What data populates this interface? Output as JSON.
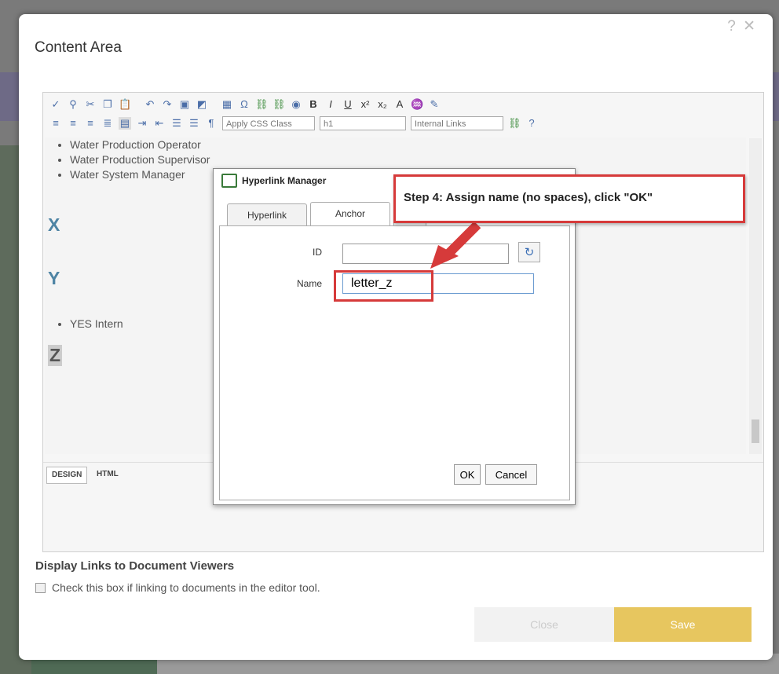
{
  "modal": {
    "title": "Content Area",
    "help_icon": "?",
    "close_icon": "✕"
  },
  "toolbar": {
    "row1_icons": [
      "spellcheck-icon",
      "find-icon",
      "cut-icon",
      "copy-icon",
      "paste-icon",
      "undo-icon",
      "redo-icon",
      "image-manager-icon",
      "image-map-icon",
      "table-icon",
      "symbol-icon",
      "hyperlink-icon",
      "remove-link-icon",
      "media-icon",
      "bold-icon",
      "italic-icon",
      "underline-icon",
      "superscript-icon",
      "subscript-icon",
      "font-color-icon",
      "highlight-icon",
      "format-stripper-icon"
    ],
    "row2_icons": [
      "align-left-icon",
      "align-center-icon",
      "align-right-icon",
      "justify-icon",
      "remove-alignment-icon",
      "indent-icon",
      "outdent-icon",
      "numbered-list-icon",
      "bullet-list-icon",
      "insert-paragraph-icon"
    ],
    "css_class": "Apply CSS Class",
    "paragraph_style": "h1",
    "internal_links": "Internal Links"
  },
  "content": {
    "list_top": [
      "Water Production Operator",
      "Water Production Supervisor",
      "Water System Manager"
    ],
    "letter_x": "X",
    "letter_y": "Y",
    "list_y": [
      "YES Intern"
    ],
    "letter_z": "Z"
  },
  "modes": {
    "design": "DESIGN",
    "html": "HTML"
  },
  "display_links": {
    "title": "Display Links to Document Viewers",
    "checkbox_label": "Check this box if linking to documents in the editor tool."
  },
  "footer": {
    "close_label": "Close",
    "save_label": "Save"
  },
  "dialog": {
    "title": "Hyperlink Manager",
    "tabs": [
      "Hyperlink",
      "Anchor",
      ""
    ],
    "active_tab": "Anchor",
    "id_label": "ID",
    "id_value": "",
    "name_label": "Name",
    "name_value": "letter_z",
    "ok_label": "OK",
    "cancel_label": "Cancel"
  },
  "callout": {
    "text": "Step 4: Assign name (no spaces), click \"OK\""
  },
  "colors": {
    "callout_border": "#d63a3a",
    "save_button": "#e7c65f",
    "heading_letters": "#4e84a4"
  }
}
